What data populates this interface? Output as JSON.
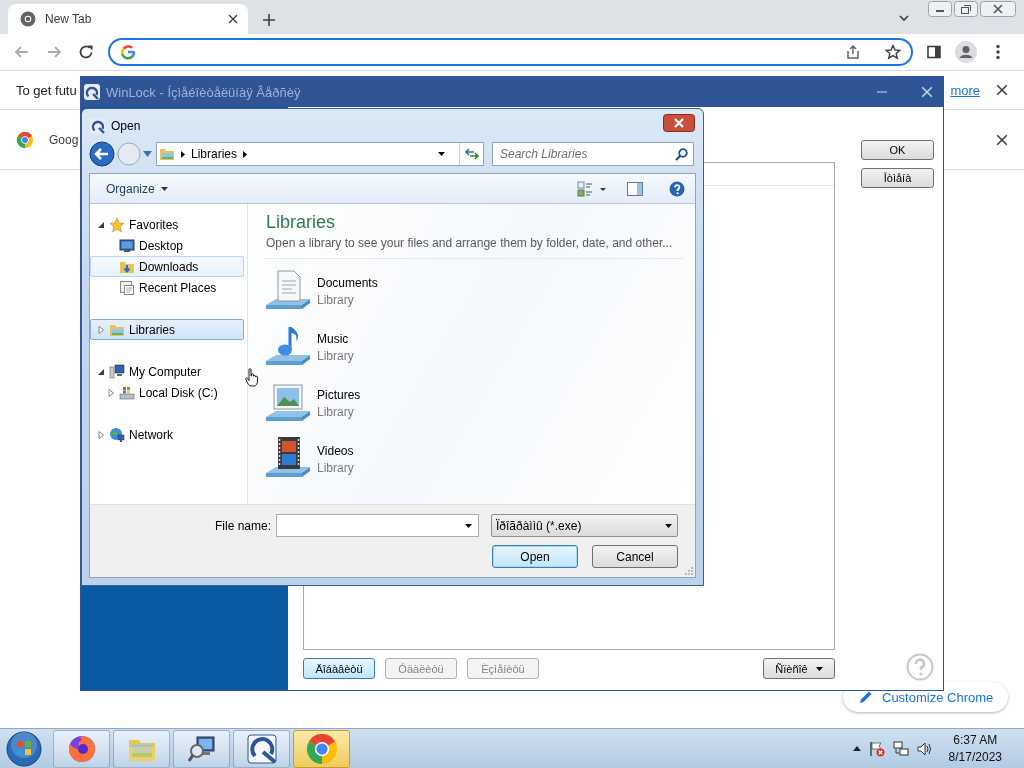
{
  "browser": {
    "tabs": [
      {
        "title": "New Tab",
        "selected": true
      }
    ],
    "infobar": {
      "text": "To get futu",
      "link": "more"
    },
    "promo_bar": {
      "text": "Goog"
    },
    "customize_button": "Customize Chrome"
  },
  "winlock": {
    "title": "WinLock - Íçìåéîèòåëüíàÿ Âåðñèÿ",
    "side_buttons": [
      "OK",
      "Îòìåíà"
    ],
    "bottom_buttons": [
      {
        "label": "Äîáàâèòü",
        "disabled": false,
        "default": true
      },
      {
        "label": "Óäàëèòü",
        "disabled": true,
        "default": false
      },
      {
        "label": "Èçìåíèòü",
        "disabled": true,
        "default": false
      }
    ],
    "menu_button": "Ñïèñîê"
  },
  "open_dialog": {
    "title": "Open",
    "address": [
      "Libraries"
    ],
    "search_placeholder": "Search Libraries",
    "organize": "Organize",
    "nav": [
      {
        "label": "Favorites",
        "kind": "star",
        "expanded": true,
        "selected": false,
        "hovered": false,
        "children": [
          {
            "label": "Desktop",
            "kind": "desktop",
            "selected": false,
            "hovered": false
          },
          {
            "label": "Downloads",
            "kind": "downloads",
            "selected": false,
            "hovered": true
          },
          {
            "label": "Recent Places",
            "kind": "recent",
            "selected": false,
            "hovered": false
          }
        ]
      },
      {
        "label": "Libraries",
        "kind": "libraries",
        "expanded": false,
        "selected": true,
        "hovered": false
      },
      {
        "label": "My Computer",
        "kind": "computer",
        "expanded": true,
        "selected": false,
        "hovered": false,
        "children": [
          {
            "label": "Local Disk (C:)",
            "kind": "disk",
            "expanded": false,
            "selected": false,
            "hovered": false
          }
        ]
      },
      {
        "label": "Network",
        "kind": "network",
        "expanded": false,
        "selected": false,
        "hovered": false
      }
    ],
    "heading": "Libraries",
    "description": "Open a library to see your files and arrange them by folder, date, and other...",
    "libraries": [
      {
        "name": "Documents",
        "type": "Library",
        "kind": "documents"
      },
      {
        "name": "Music",
        "type": "Library",
        "kind": "music"
      },
      {
        "name": "Pictures",
        "type": "Library",
        "kind": "pictures"
      },
      {
        "name": "Videos",
        "type": "Library",
        "kind": "videos"
      }
    ],
    "file_name_label": "File name:",
    "file_type": "Ïðîãðàììû (*.exe)",
    "buttons": [
      {
        "label": "Open",
        "default": true
      },
      {
        "label": "Cancel",
        "default": false
      }
    ]
  },
  "taskbar": {
    "apps": [
      {
        "kind": "firefox",
        "selected": false
      },
      {
        "kind": "explorer",
        "selected": false
      },
      {
        "kind": "magnifier",
        "selected": false
      },
      {
        "kind": "winlock",
        "selected": false
      },
      {
        "kind": "chrome",
        "selected": true
      }
    ],
    "clock": {
      "time": "6:37 AM",
      "date": "8/17/2023"
    }
  }
}
